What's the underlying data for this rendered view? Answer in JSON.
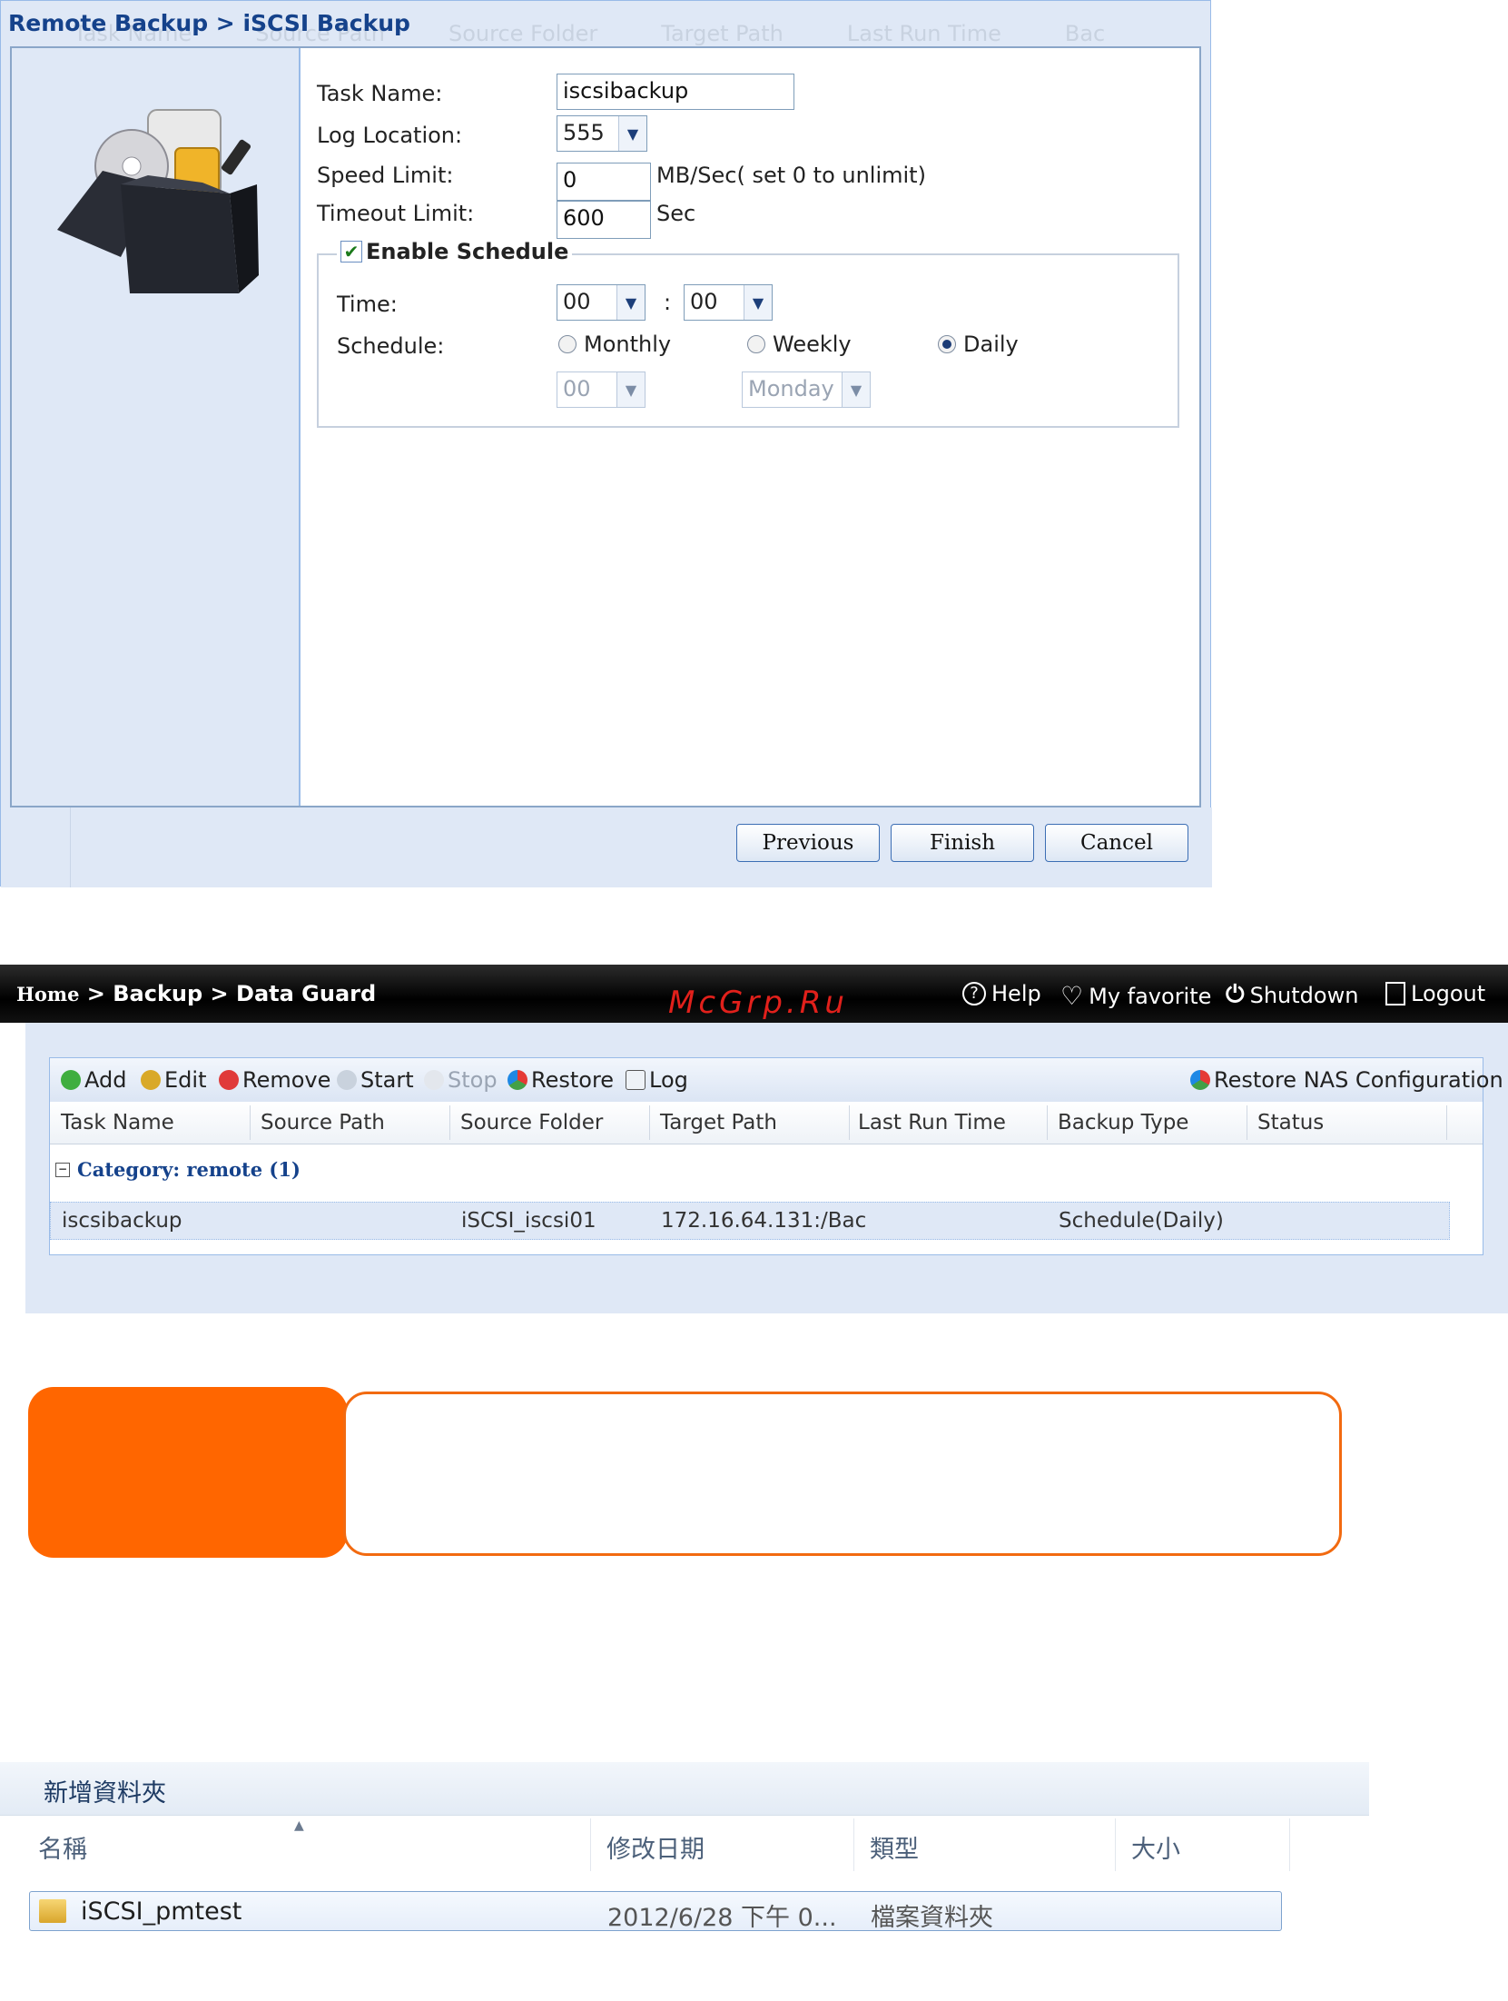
{
  "dialog": {
    "title": "Remote Backup > iSCSI Backup",
    "ghost_columns": [
      "Task Name",
      "Source Path",
      "Source Folder",
      "Target Path",
      "Last Run Time",
      "Bac"
    ],
    "task_name_label": "Task Name:",
    "task_name_value": "iscsibackup",
    "log_location_label": "Log Location:",
    "log_location_value": "555",
    "speed_limit_label": "Speed Limit:",
    "speed_limit_value": "0",
    "speed_limit_unit": "MB/Sec( set 0 to unlimit)",
    "timeout_limit_label": "Timeout Limit:",
    "timeout_limit_value": "600",
    "timeout_unit": "Sec",
    "schedule_group": {
      "legend": "Enable Schedule",
      "enabled": true,
      "time_label": "Time:",
      "hour": "00",
      "time_sep": ":",
      "minute": "00",
      "schedule_label": "Schedule:",
      "options": [
        "Monthly",
        "Weekly",
        "Daily"
      ],
      "selected": "Daily",
      "monthly_day": "00",
      "weekly_day": "Monday"
    },
    "buttons": {
      "previous": "Previous",
      "finish": "Finish",
      "cancel": "Cancel"
    }
  },
  "data_guard": {
    "breadcrumb_home": "Home",
    "breadcrumb_rest": " > Backup > Data Guard",
    "watermark": "McGrp.Ru",
    "menu": {
      "help": "Help",
      "favorite": "My favorite",
      "shutdown": "Shutdown",
      "logout": "Logout"
    },
    "toolbar": {
      "add": "Add",
      "edit": "Edit",
      "remove": "Remove",
      "start": "Start",
      "stop": "Stop",
      "restore": "Restore",
      "log": "Log",
      "restore_nas": "Restore NAS Configuration"
    },
    "columns": [
      "Task Name",
      "Source Path",
      "Source Folder",
      "Target Path",
      "Last Run Time",
      "Backup Type",
      "Status"
    ],
    "category": "Category: remote (1)",
    "rows": [
      {
        "task_name": "iscsibackup",
        "source_path": "",
        "source_folder": "iSCSI_iscsi01",
        "target_path": "172.16.64.131:/Bac",
        "last_run_time": "",
        "backup_type": "Schedule(Daily)",
        "status": ""
      }
    ]
  },
  "explorer": {
    "new_folder": "新增資料夾",
    "columns": {
      "name": "名稱",
      "modified": "修改日期",
      "type": "類型",
      "size": "大小"
    },
    "rows": [
      {
        "name": "iSCSI_pmtest",
        "modified": "2012/6/28 下午 0...",
        "type": "檔案資料夾",
        "size": ""
      }
    ]
  },
  "colors": {
    "accent_orange": "#ff6600",
    "header_blue": "#15428b",
    "panel_bg": "#dfe8f6"
  }
}
